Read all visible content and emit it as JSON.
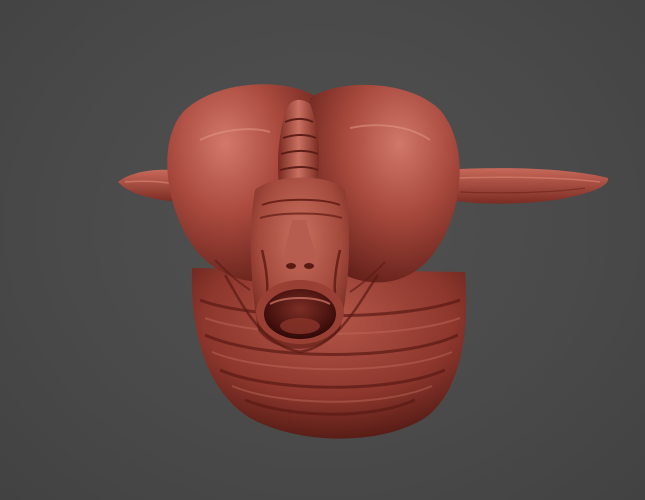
{
  "scene": {
    "subject": "sculpted-creature-head",
    "colors": {
      "background": "#4b4b4b",
      "clay_base": "#a4463a",
      "clay_light": "#d97a6a",
      "clay_dark": "#5a1c16",
      "mouth_inside": "#3a0e0b"
    }
  }
}
